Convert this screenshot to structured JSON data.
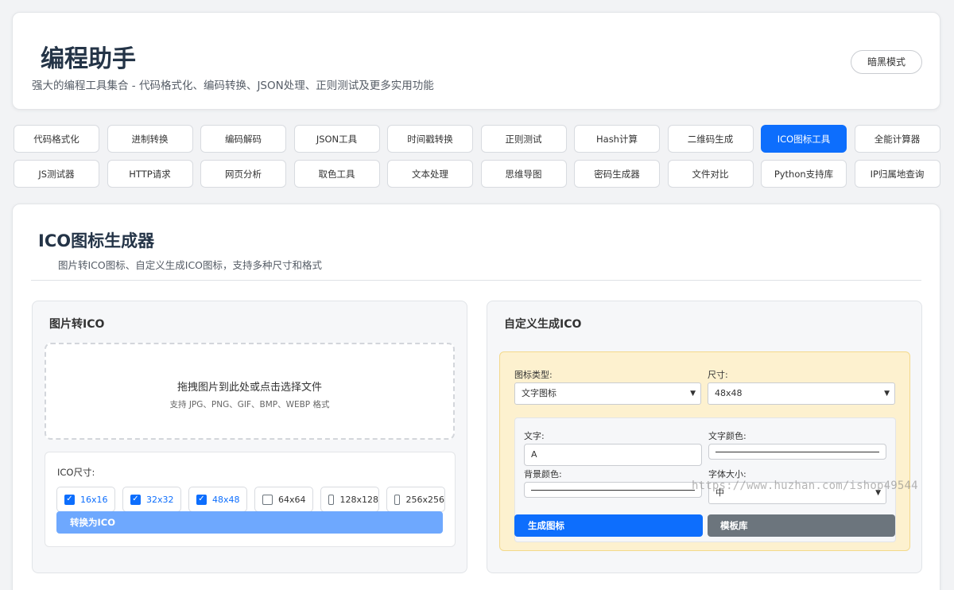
{
  "header": {
    "title": "编程助手",
    "subtitle": "强大的编程工具集合 - 代码格式化、编码转换、JSON处理、正则测试及更多实用功能",
    "dark_mode_label": "暗黑模式"
  },
  "nav": {
    "items": [
      {
        "label": "代码格式化"
      },
      {
        "label": "进制转换"
      },
      {
        "label": "编码解码"
      },
      {
        "label": "JSON工具"
      },
      {
        "label": "时间戳转换"
      },
      {
        "label": "正则测试"
      },
      {
        "label": "Hash计算"
      },
      {
        "label": "二维码生成"
      },
      {
        "label": "ICO图标工具",
        "active": true
      },
      {
        "label": "全能计算器"
      },
      {
        "label": "JS测试器"
      },
      {
        "label": "HTTP请求"
      },
      {
        "label": "网页分析"
      },
      {
        "label": "取色工具"
      },
      {
        "label": "文本处理"
      },
      {
        "label": "思维导图"
      },
      {
        "label": "密码生成器"
      },
      {
        "label": "文件对比"
      },
      {
        "label": "Python支持库"
      },
      {
        "label": "IP归属地查询"
      }
    ]
  },
  "tool": {
    "title": "ICO图标生成器",
    "description": "图片转ICO图标、自定义生成ICO图标，支持多种尺寸和格式"
  },
  "image_to_ico": {
    "title": "图片转ICO",
    "dropzone_main": "拖拽图片到此处或点击选择文件",
    "dropzone_sub": "支持 JPG、PNG、GIF、BMP、WEBP 格式",
    "size_label": "ICO尺寸:",
    "sizes": [
      {
        "label": "16x16",
        "checked": true
      },
      {
        "label": "32x32",
        "checked": true
      },
      {
        "label": "48x48",
        "checked": true
      },
      {
        "label": "64x64",
        "checked": false
      },
      {
        "label": "128x128",
        "checked": false
      },
      {
        "label": "256x256",
        "checked": false
      }
    ],
    "convert_label": "转换为ICO"
  },
  "custom_ico": {
    "title": "自定义生成ICO",
    "icon_type_label": "图标类型:",
    "icon_type_value": "文字图标",
    "size_label": "尺寸:",
    "size_value": "48x48",
    "text_label": "文字:",
    "text_value": "A",
    "text_color_label": "文字颜色:",
    "bg_color_label": "背景颜色:",
    "font_size_label": "字体大小:",
    "font_size_value": "中",
    "generate_label": "生成图标",
    "template_label": "模板库"
  },
  "watermark": "https://www.huzhan.com/ishop49544"
}
